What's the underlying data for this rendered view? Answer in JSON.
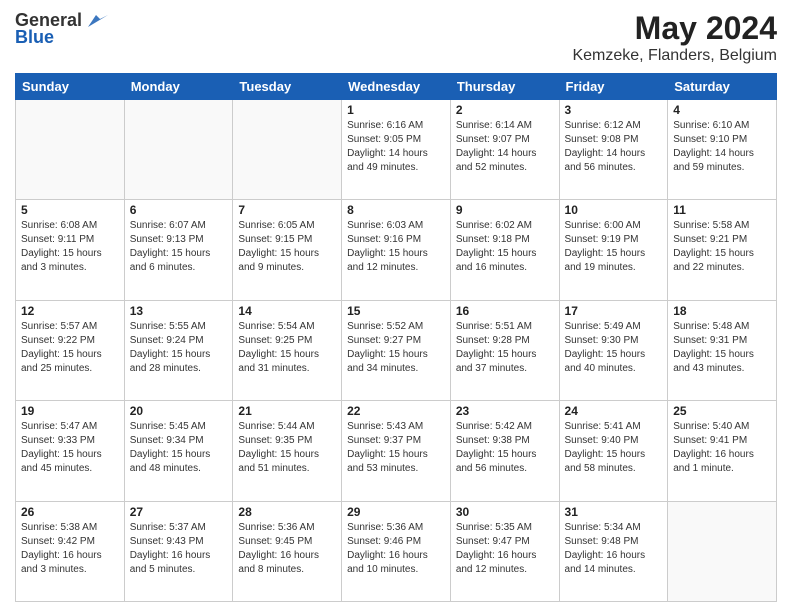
{
  "logo": {
    "general": "General",
    "blue": "Blue"
  },
  "title": "May 2024",
  "subtitle": "Kemzeke, Flanders, Belgium",
  "days_of_week": [
    "Sunday",
    "Monday",
    "Tuesday",
    "Wednesday",
    "Thursday",
    "Friday",
    "Saturday"
  ],
  "weeks": [
    [
      {
        "day": "",
        "info": ""
      },
      {
        "day": "",
        "info": ""
      },
      {
        "day": "",
        "info": ""
      },
      {
        "day": "1",
        "info": "Sunrise: 6:16 AM\nSunset: 9:05 PM\nDaylight: 14 hours\nand 49 minutes."
      },
      {
        "day": "2",
        "info": "Sunrise: 6:14 AM\nSunset: 9:07 PM\nDaylight: 14 hours\nand 52 minutes."
      },
      {
        "day": "3",
        "info": "Sunrise: 6:12 AM\nSunset: 9:08 PM\nDaylight: 14 hours\nand 56 minutes."
      },
      {
        "day": "4",
        "info": "Sunrise: 6:10 AM\nSunset: 9:10 PM\nDaylight: 14 hours\nand 59 minutes."
      }
    ],
    [
      {
        "day": "5",
        "info": "Sunrise: 6:08 AM\nSunset: 9:11 PM\nDaylight: 15 hours\nand 3 minutes."
      },
      {
        "day": "6",
        "info": "Sunrise: 6:07 AM\nSunset: 9:13 PM\nDaylight: 15 hours\nand 6 minutes."
      },
      {
        "day": "7",
        "info": "Sunrise: 6:05 AM\nSunset: 9:15 PM\nDaylight: 15 hours\nand 9 minutes."
      },
      {
        "day": "8",
        "info": "Sunrise: 6:03 AM\nSunset: 9:16 PM\nDaylight: 15 hours\nand 12 minutes."
      },
      {
        "day": "9",
        "info": "Sunrise: 6:02 AM\nSunset: 9:18 PM\nDaylight: 15 hours\nand 16 minutes."
      },
      {
        "day": "10",
        "info": "Sunrise: 6:00 AM\nSunset: 9:19 PM\nDaylight: 15 hours\nand 19 minutes."
      },
      {
        "day": "11",
        "info": "Sunrise: 5:58 AM\nSunset: 9:21 PM\nDaylight: 15 hours\nand 22 minutes."
      }
    ],
    [
      {
        "day": "12",
        "info": "Sunrise: 5:57 AM\nSunset: 9:22 PM\nDaylight: 15 hours\nand 25 minutes."
      },
      {
        "day": "13",
        "info": "Sunrise: 5:55 AM\nSunset: 9:24 PM\nDaylight: 15 hours\nand 28 minutes."
      },
      {
        "day": "14",
        "info": "Sunrise: 5:54 AM\nSunset: 9:25 PM\nDaylight: 15 hours\nand 31 minutes."
      },
      {
        "day": "15",
        "info": "Sunrise: 5:52 AM\nSunset: 9:27 PM\nDaylight: 15 hours\nand 34 minutes."
      },
      {
        "day": "16",
        "info": "Sunrise: 5:51 AM\nSunset: 9:28 PM\nDaylight: 15 hours\nand 37 minutes."
      },
      {
        "day": "17",
        "info": "Sunrise: 5:49 AM\nSunset: 9:30 PM\nDaylight: 15 hours\nand 40 minutes."
      },
      {
        "day": "18",
        "info": "Sunrise: 5:48 AM\nSunset: 9:31 PM\nDaylight: 15 hours\nand 43 minutes."
      }
    ],
    [
      {
        "day": "19",
        "info": "Sunrise: 5:47 AM\nSunset: 9:33 PM\nDaylight: 15 hours\nand 45 minutes."
      },
      {
        "day": "20",
        "info": "Sunrise: 5:45 AM\nSunset: 9:34 PM\nDaylight: 15 hours\nand 48 minutes."
      },
      {
        "day": "21",
        "info": "Sunrise: 5:44 AM\nSunset: 9:35 PM\nDaylight: 15 hours\nand 51 minutes."
      },
      {
        "day": "22",
        "info": "Sunrise: 5:43 AM\nSunset: 9:37 PM\nDaylight: 15 hours\nand 53 minutes."
      },
      {
        "day": "23",
        "info": "Sunrise: 5:42 AM\nSunset: 9:38 PM\nDaylight: 15 hours\nand 56 minutes."
      },
      {
        "day": "24",
        "info": "Sunrise: 5:41 AM\nSunset: 9:40 PM\nDaylight: 15 hours\nand 58 minutes."
      },
      {
        "day": "25",
        "info": "Sunrise: 5:40 AM\nSunset: 9:41 PM\nDaylight: 16 hours\nand 1 minute."
      }
    ],
    [
      {
        "day": "26",
        "info": "Sunrise: 5:38 AM\nSunset: 9:42 PM\nDaylight: 16 hours\nand 3 minutes."
      },
      {
        "day": "27",
        "info": "Sunrise: 5:37 AM\nSunset: 9:43 PM\nDaylight: 16 hours\nand 5 minutes."
      },
      {
        "day": "28",
        "info": "Sunrise: 5:36 AM\nSunset: 9:45 PM\nDaylight: 16 hours\nand 8 minutes."
      },
      {
        "day": "29",
        "info": "Sunrise: 5:36 AM\nSunset: 9:46 PM\nDaylight: 16 hours\nand 10 minutes."
      },
      {
        "day": "30",
        "info": "Sunrise: 5:35 AM\nSunset: 9:47 PM\nDaylight: 16 hours\nand 12 minutes."
      },
      {
        "day": "31",
        "info": "Sunrise: 5:34 AM\nSunset: 9:48 PM\nDaylight: 16 hours\nand 14 minutes."
      },
      {
        "day": "",
        "info": ""
      }
    ]
  ]
}
